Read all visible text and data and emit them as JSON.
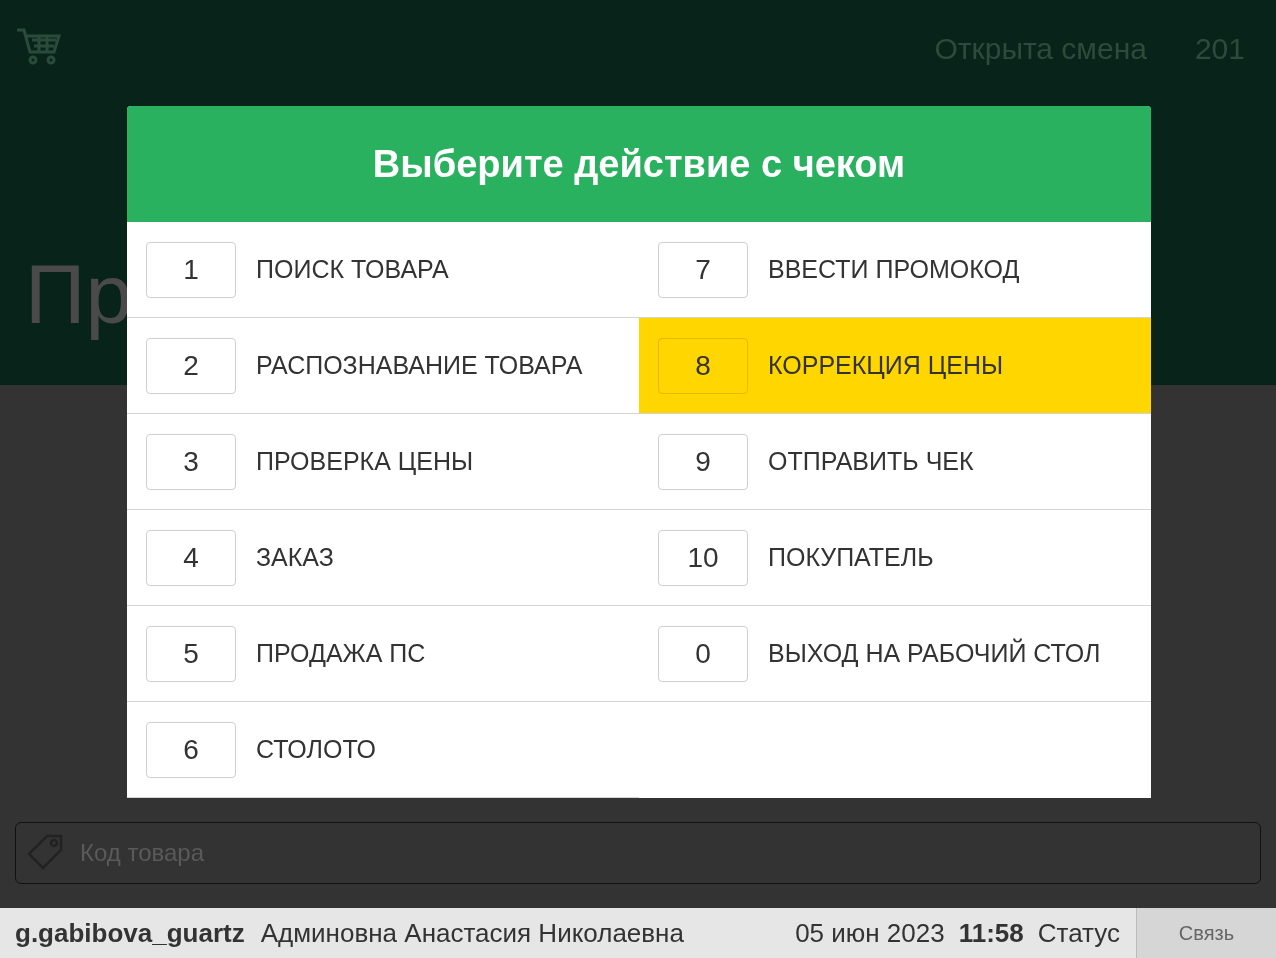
{
  "top_bar": {
    "shift_status": "Открыта смена",
    "number": "201"
  },
  "background_heading": "Пр",
  "dialog": {
    "title": "Выберите действие с чеком",
    "items": [
      {
        "key": "1",
        "label": "ПОИСК ТОВАРА",
        "selected": false
      },
      {
        "key": "2",
        "label": "РАСПОЗНАВАНИЕ ТОВАРА",
        "selected": false
      },
      {
        "key": "3",
        "label": "ПРОВЕРКА ЦЕНЫ",
        "selected": false
      },
      {
        "key": "4",
        "label": "ЗАКАЗ",
        "selected": false
      },
      {
        "key": "5",
        "label": "ПРОДАЖА ПС",
        "selected": false
      },
      {
        "key": "6",
        "label": "СТОЛОТО",
        "selected": false
      },
      {
        "key": "7",
        "label": "ВВЕСТИ ПРОМОКОД",
        "selected": false
      },
      {
        "key": "8",
        "label": "КОРРЕКЦИЯ ЦЕНЫ",
        "selected": true
      },
      {
        "key": "9",
        "label": "ОТПРАВИТЬ ЧЕК",
        "selected": false
      },
      {
        "key": "10",
        "label": "ПОКУПАТЕЛЬ",
        "selected": false
      },
      {
        "key": "0",
        "label": "ВЫХОД НА РАБОЧИЙ СТОЛ",
        "selected": false
      }
    ]
  },
  "product_code_field": {
    "placeholder": "Код товара"
  },
  "status_bar": {
    "login": "g.gabibova_guartz",
    "user_name": "Админовна Анастасия Николаевна",
    "date": "05 июн 2023",
    "time": "11:58",
    "status": "Статус",
    "connection_button": "Связь"
  }
}
